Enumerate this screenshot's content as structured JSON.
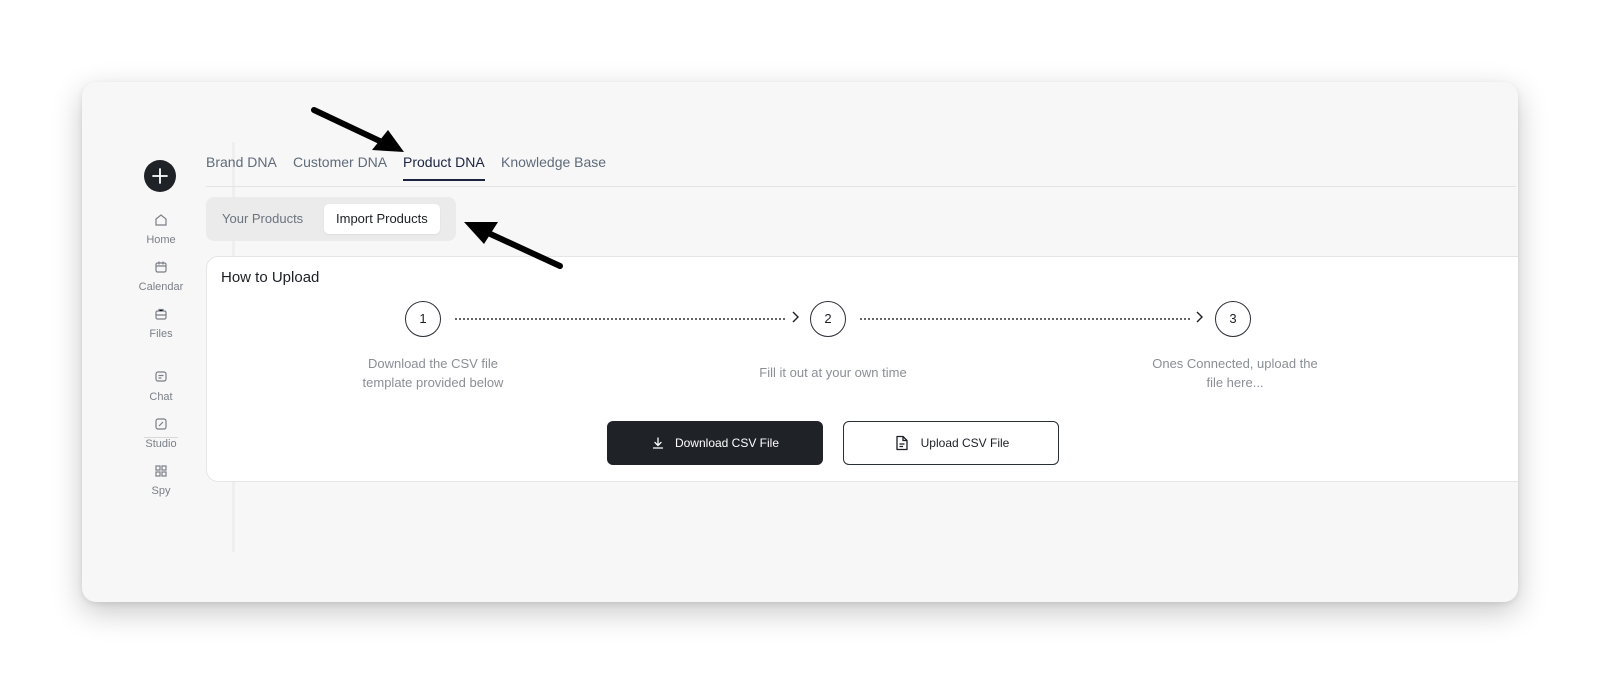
{
  "sidebar": {
    "items": [
      {
        "label": "Home",
        "icon": "home-icon"
      },
      {
        "label": "Calendar",
        "icon": "calendar-icon"
      },
      {
        "label": "Files",
        "icon": "files-icon"
      },
      {
        "label": "Chat",
        "icon": "chat-icon"
      },
      {
        "label": "Studio",
        "icon": "studio-icon"
      },
      {
        "label": "Spy",
        "icon": "spy-icon"
      }
    ]
  },
  "tabs": [
    {
      "label": "Brand DNA"
    },
    {
      "label": "Customer DNA"
    },
    {
      "label": "Product DNA",
      "active": true
    },
    {
      "label": "Knowledge Base"
    }
  ],
  "subtabs": [
    {
      "label": "Your Products"
    },
    {
      "label": "Import Products",
      "active": true
    }
  ],
  "upload": {
    "title": "How to Upload",
    "steps": [
      {
        "number": "1",
        "text": "Download the CSV file template provided below"
      },
      {
        "number": "2",
        "text": "Fill it out at your own time"
      },
      {
        "number": "3",
        "text": "Ones Connected, upload the file here..."
      }
    ],
    "download_label": "Download CSV File",
    "upload_label": "Upload CSV File"
  },
  "colors": {
    "dark": "#1f2328",
    "active_tab": "#1b2340",
    "muted": "#8a8f96"
  }
}
